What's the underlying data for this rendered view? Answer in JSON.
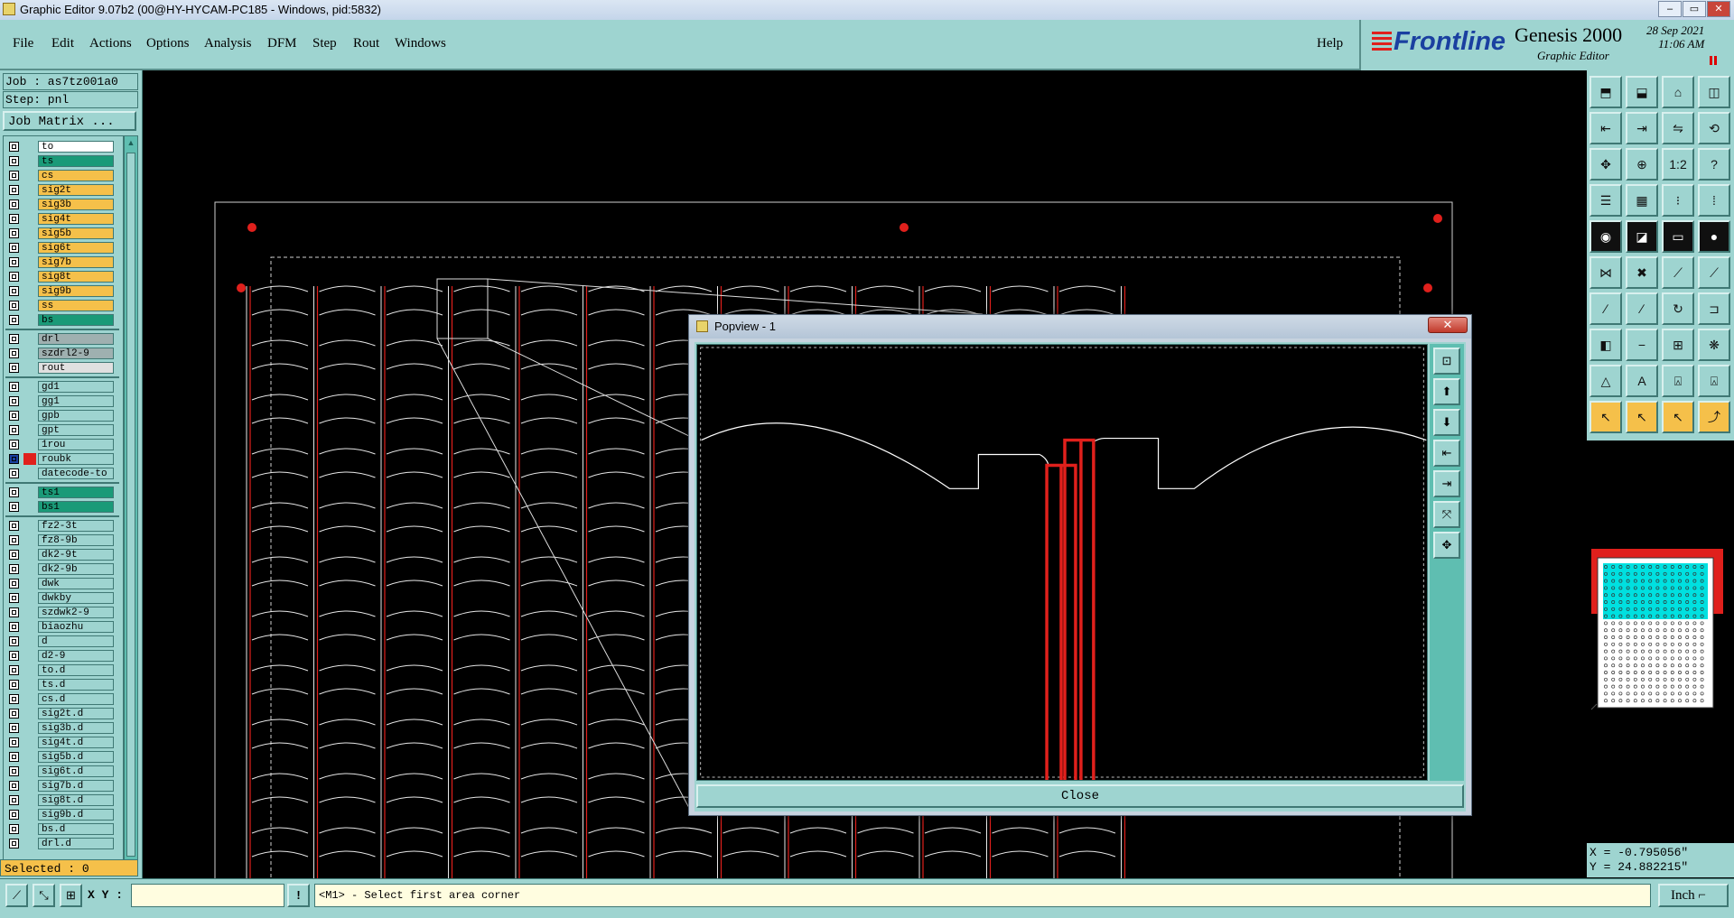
{
  "window": {
    "title": "Graphic Editor 9.07b2 (00@HY-HYCAM-PC185 - Windows, pid:5832)",
    "minimize": "–",
    "maximize": "▭",
    "close": "✕"
  },
  "menu": {
    "items": [
      "File",
      "Edit",
      "Actions",
      "Options",
      "Analysis",
      "DFM",
      "Step",
      "Rout",
      "Windows"
    ],
    "help": "Help"
  },
  "brand": {
    "logo": "Frontline",
    "product": "Genesis 2000",
    "subtitle": "Graphic Editor",
    "date": "28 Sep 2021",
    "time": "11:06 AM"
  },
  "job": {
    "job_line": "Job : as7tz001a0",
    "step_line": "Step: pnl",
    "matrix_button": "Job Matrix ..."
  },
  "layers": [
    {
      "name": "to",
      "bg": "#ffffff",
      "sw": ""
    },
    {
      "name": "ts",
      "bg": "#1a9a78",
      "sw": ""
    },
    {
      "name": "cs",
      "bg": "#f5c04a",
      "sw": ""
    },
    {
      "name": "sig2t",
      "bg": "#f5c04a",
      "sw": ""
    },
    {
      "name": "sig3b",
      "bg": "#f5c04a",
      "sw": ""
    },
    {
      "name": "sig4t",
      "bg": "#f5c04a",
      "sw": ""
    },
    {
      "name": "sig5b",
      "bg": "#f5c04a",
      "sw": ""
    },
    {
      "name": "sig6t",
      "bg": "#f5c04a",
      "sw": ""
    },
    {
      "name": "sig7b",
      "bg": "#f5c04a",
      "sw": ""
    },
    {
      "name": "sig8t",
      "bg": "#f5c04a",
      "sw": ""
    },
    {
      "name": "sig9b",
      "bg": "#f5c04a",
      "sw": ""
    },
    {
      "name": "ss",
      "bg": "#f5c04a",
      "sw": ""
    },
    {
      "name": "bs",
      "bg": "#1a9a78",
      "sw": ""
    },
    {
      "name": "drl",
      "bg": "#9fb0b0",
      "sw": ""
    },
    {
      "name": "szdrl2-9",
      "bg": "#9fb0b0",
      "sw": ""
    },
    {
      "name": "rout",
      "bg": "#e0e0e0",
      "sw": ""
    },
    {
      "name": "gd1",
      "bg": "#9ed4d0",
      "sw": ""
    },
    {
      "name": "gg1",
      "bg": "#9ed4d0",
      "sw": ""
    },
    {
      "name": "gpb",
      "bg": "#9ed4d0",
      "sw": ""
    },
    {
      "name": "gpt",
      "bg": "#9ed4d0",
      "sw": ""
    },
    {
      "name": "1rou",
      "bg": "#9ed4d0",
      "sw": ""
    },
    {
      "name": "roubk",
      "bg": "#9ed4d0",
      "sw": "#e0201c"
    },
    {
      "name": "datecode-to",
      "bg": "#9ed4d0",
      "sw": ""
    },
    {
      "name": "ts1",
      "bg": "#1a9a78",
      "sw": ""
    },
    {
      "name": "bs1",
      "bg": "#1a9a78",
      "sw": ""
    },
    {
      "name": "fz2-3t",
      "bg": "#9ed4d0",
      "sw": ""
    },
    {
      "name": "fz8-9b",
      "bg": "#9ed4d0",
      "sw": ""
    },
    {
      "name": "dk2-9t",
      "bg": "#9ed4d0",
      "sw": ""
    },
    {
      "name": "dk2-9b",
      "bg": "#9ed4d0",
      "sw": ""
    },
    {
      "name": "dwk",
      "bg": "#9ed4d0",
      "sw": ""
    },
    {
      "name": "dwkby",
      "bg": "#9ed4d0",
      "sw": ""
    },
    {
      "name": "szdwk2-9",
      "bg": "#9ed4d0",
      "sw": ""
    },
    {
      "name": "biaozhu",
      "bg": "#9ed4d0",
      "sw": ""
    },
    {
      "name": "d",
      "bg": "#9ed4d0",
      "sw": ""
    },
    {
      "name": "d2-9",
      "bg": "#9ed4d0",
      "sw": ""
    },
    {
      "name": "to.d",
      "bg": "#9ed4d0",
      "sw": ""
    },
    {
      "name": "ts.d",
      "bg": "#9ed4d0",
      "sw": ""
    },
    {
      "name": "cs.d",
      "bg": "#9ed4d0",
      "sw": ""
    },
    {
      "name": "sig2t.d",
      "bg": "#9ed4d0",
      "sw": ""
    },
    {
      "name": "sig3b.d",
      "bg": "#9ed4d0",
      "sw": ""
    },
    {
      "name": "sig4t.d",
      "bg": "#9ed4d0",
      "sw": ""
    },
    {
      "name": "sig5b.d",
      "bg": "#9ed4d0",
      "sw": ""
    },
    {
      "name": "sig6t.d",
      "bg": "#9ed4d0",
      "sw": ""
    },
    {
      "name": "sig7b.d",
      "bg": "#9ed4d0",
      "sw": ""
    },
    {
      "name": "sig8t.d",
      "bg": "#9ed4d0",
      "sw": ""
    },
    {
      "name": "sig9b.d",
      "bg": "#9ed4d0",
      "sw": ""
    },
    {
      "name": "bs.d",
      "bg": "#9ed4d0",
      "sw": ""
    },
    {
      "name": "drl.d",
      "bg": "#9ed4d0",
      "sw": ""
    }
  ],
  "selected": "Selected : 0",
  "coords": {
    "x": "X = -0.795056\"",
    "y": "Y = 24.882215\""
  },
  "statusbar": {
    "xy_label": "X Y :",
    "xy_value": "",
    "bang": "!",
    "message": "<M1> - Select first area corner",
    "unit": "Inch",
    "unit_icon": "⌐"
  },
  "popup": {
    "title": "Popview - 1",
    "close_label": "Close",
    "x_label": "✕"
  },
  "colors": {
    "panel": "#9ed4d0",
    "accent_red": "#e0201c",
    "highlight": "#f5c04a"
  }
}
